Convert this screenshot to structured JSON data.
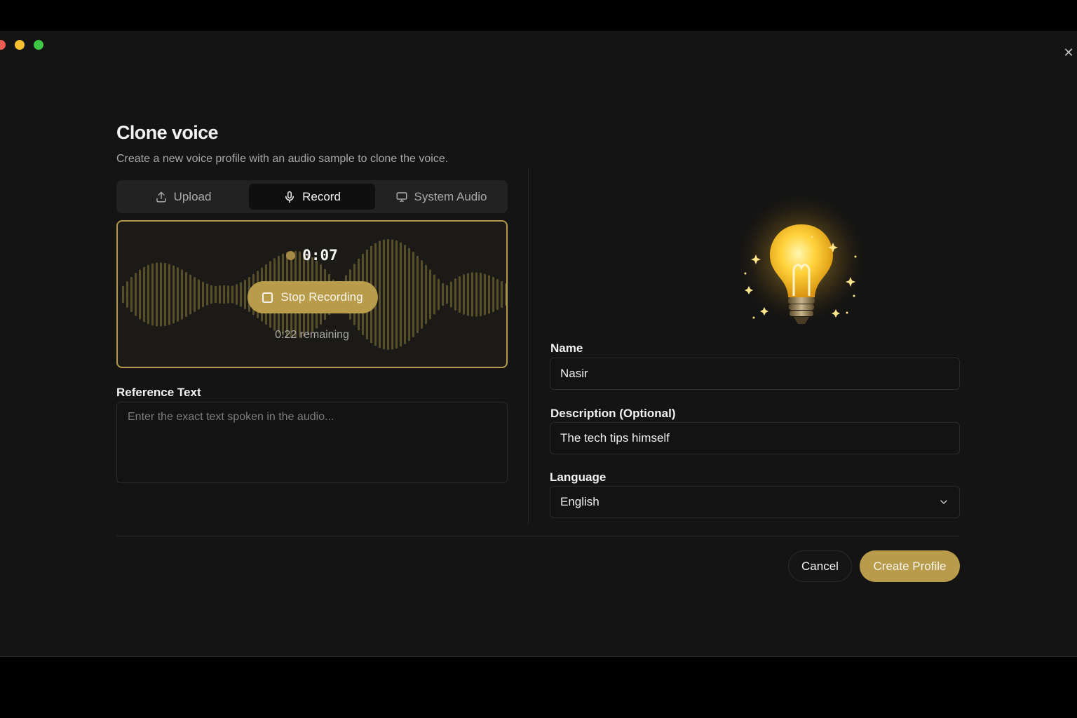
{
  "window": {
    "close_icon": "close-icon"
  },
  "dialog": {
    "title": "Clone voice",
    "subtitle": "Create a new voice profile with an audio sample to clone the voice."
  },
  "tabs": [
    {
      "label": "Upload",
      "icon": "upload-icon",
      "active": false
    },
    {
      "label": "Record",
      "icon": "microphone-icon",
      "active": true
    },
    {
      "label": "System Audio",
      "icon": "monitor-icon",
      "active": false
    }
  ],
  "recorder": {
    "elapsed": "0:07",
    "stop_label": "Stop Recording",
    "remaining": "0:22 remaining",
    "accent_color": "#b99c4b"
  },
  "reference": {
    "label": "Reference Text",
    "placeholder": "Enter the exact text spoken in the audio...",
    "value": ""
  },
  "form": {
    "name_label": "Name",
    "name_value": "Nasir",
    "description_label": "Description (Optional)",
    "description_value": "The tech tips himself",
    "language_label": "Language",
    "language_value": "English"
  },
  "footer": {
    "cancel_label": "Cancel",
    "create_label": "Create Profile"
  },
  "colors": {
    "accent": "#b99c4b",
    "background": "#141414"
  }
}
